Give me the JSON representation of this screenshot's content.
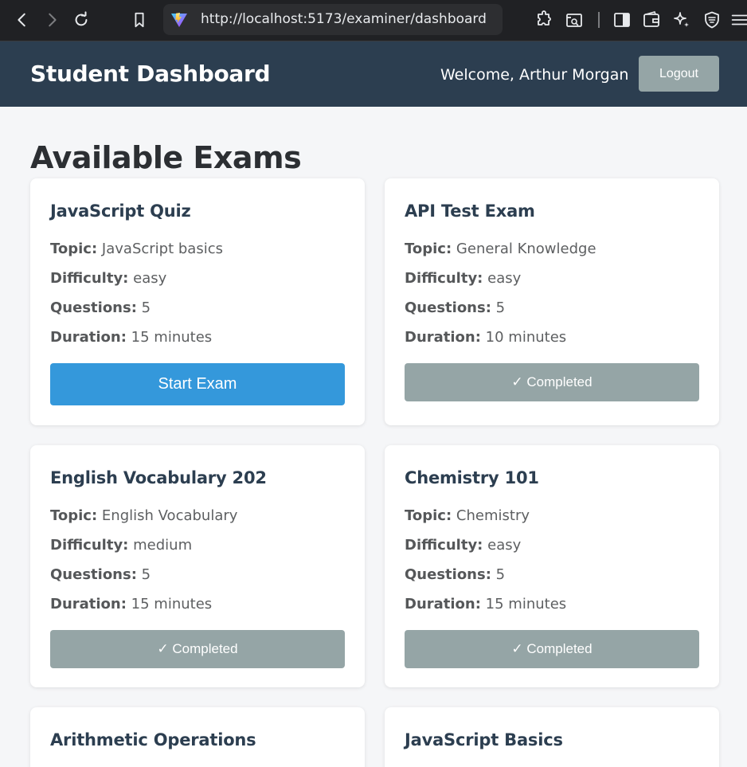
{
  "browser": {
    "url": "http://localhost:5173/examiner/dashboard"
  },
  "header": {
    "title": "Student Dashboard",
    "welcome": "Welcome, Arthur Morgan",
    "logout_label": "Logout"
  },
  "main": {
    "title": "Available Exams"
  },
  "field_labels": {
    "topic": "Topic:",
    "difficulty": "Difficulty:",
    "questions": "Questions:",
    "duration": "Duration:"
  },
  "exams": [
    {
      "title": "JavaScript Quiz",
      "topic": "JavaScript basics",
      "difficulty": "easy",
      "questions": "5",
      "duration": "15 minutes",
      "action": "Start Exam"
    },
    {
      "title": "API Test Exam",
      "topic": "General Knowledge",
      "difficulty": "easy",
      "questions": "5",
      "duration": "10 minutes",
      "action": "✓ Completed"
    },
    {
      "title": "English Vocabulary 202",
      "topic": "English Vocabulary",
      "difficulty": "medium",
      "questions": "5",
      "duration": "15 minutes",
      "action": "✓ Completed"
    },
    {
      "title": "Chemistry 101",
      "topic": "Chemistry",
      "difficulty": "easy",
      "questions": "5",
      "duration": "15 minutes",
      "action": "✓ Completed"
    },
    {
      "title": "Arithmetic Operations"
    },
    {
      "title": "JavaScript Basics"
    }
  ],
  "colors": {
    "header_bg": "#2c3e50",
    "start_button": "#3498db",
    "completed_button": "#95a5a6"
  }
}
